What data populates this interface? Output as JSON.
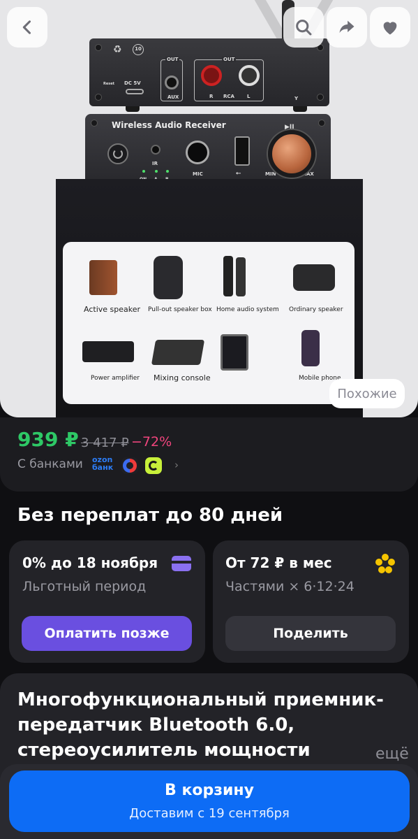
{
  "hero": {
    "device_top": {
      "reset": "Reset",
      "dc": "DC 5V",
      "aux_out": "OUT",
      "aux": "AUX",
      "rca_out": "OUT",
      "rca": "RCA",
      "r": "R",
      "l": "L",
      "badge": "10",
      "y": "Y"
    },
    "device_bottom": {
      "title": "Wireless Audio Receiver",
      "ir": "IR",
      "mic": "MIC",
      "min": "MIN",
      "max": "MAX",
      "on": "ON",
      "a": "A",
      "b": "B",
      "play": "▶II"
    },
    "panel_items": [
      "Active speaker",
      "Pull-out speaker box",
      "Home audio system",
      "Ordinary speaker",
      "Power amplifier",
      "Mixing console",
      "Mobile phone"
    ],
    "similar_label": "Похожие"
  },
  "price": {
    "current": "939 ₽",
    "old": "3 417 ₽",
    "discount": "−72%",
    "banks_label": "С банками",
    "ozon_logo": "ozon\nбанк",
    "colors": {
      "price": "#2ec866",
      "discount": "#f0457d"
    }
  },
  "installment": {
    "title": "Без переплат до 80 дней",
    "left": {
      "title": "0% до 18 ноября",
      "sub": "Льготный период",
      "button": "Оплатить позже"
    },
    "right": {
      "title": "От 72 ₽ в мес",
      "sub": "Частями × 6·12·24",
      "button": "Поделить"
    }
  },
  "product": {
    "title": "Многофункциональный приемник-передатчик Bluetooth 6.0, стереоусилитель мощности",
    "more": "ещё"
  },
  "cart": {
    "label": "В корзину",
    "sub": "Доставим с 19 сентября",
    "color": "#0d6cf5"
  }
}
